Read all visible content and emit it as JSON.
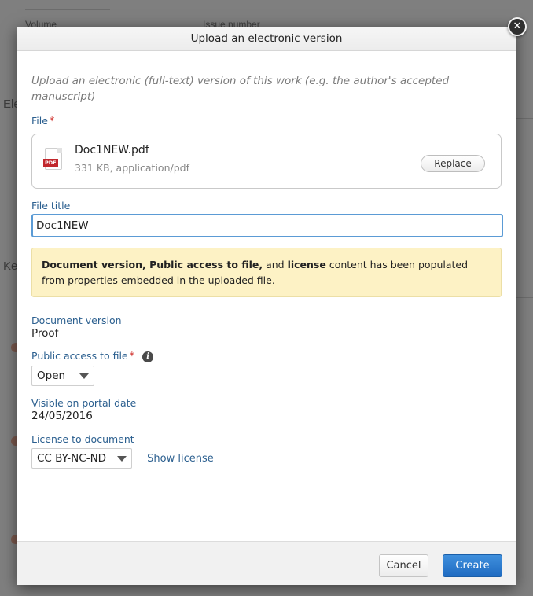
{
  "background": {
    "volume_label": "Volume",
    "issue_label": "Issue number",
    "left_fragment_1": "Ele",
    "left_fragment_2": "Ke"
  },
  "dialog": {
    "title": "Upload an electronic version",
    "intro": "Upload an electronic (full-text) version of this work (e.g. the author's accepted manuscript)",
    "file_label": "File",
    "required_marker": "*",
    "file": {
      "icon_tag": "PDF",
      "name": "Doc1NEW.pdf",
      "meta": "331 KB, application/pdf",
      "replace_label": "Replace"
    },
    "file_title_label": "File title",
    "file_title_value": "Doc1NEW",
    "notice": {
      "bold1": "Document version, Public access to file,",
      "text1": " and ",
      "bold2": "license",
      "text2": " content has been populated from properties embedded in the uploaded file."
    },
    "document_version_label": "Document version",
    "document_version_value": "Proof",
    "public_access_label": "Public access to file",
    "public_access_value": "Open",
    "visible_date_label": "Visible on portal date",
    "visible_date_value": "24/05/2016",
    "license_label": "License to document",
    "license_value": "CC BY-NC-ND",
    "show_license_label": "Show license",
    "cancel_label": "Cancel",
    "create_label": "Create",
    "close_glyph": "✕"
  },
  "colors": {
    "accent": "#1f6bc2",
    "label": "#2b5f8f",
    "required": "#d0312d",
    "notice_bg": "#fdf2c5"
  }
}
